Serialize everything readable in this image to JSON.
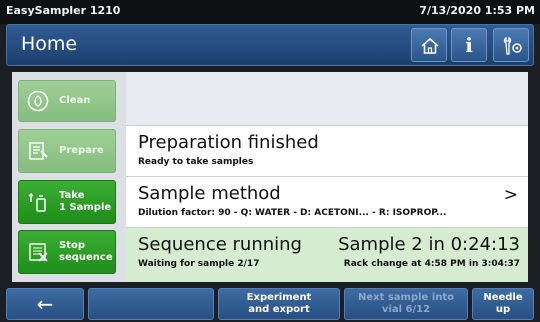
{
  "status_bar": {
    "app_name": "EasySampler 1210",
    "datetime": "7/13/2020 1:53 PM"
  },
  "header": {
    "title": "Home",
    "icons": [
      "home-icon",
      "info-icon",
      "tools-icon"
    ],
    "info_glyph": "i"
  },
  "side_buttons": [
    {
      "label_line1": "Clean",
      "label_line2": "",
      "state": "disabled",
      "icon": "clean-icon"
    },
    {
      "label_line1": "Prepare",
      "label_line2": "",
      "state": "disabled",
      "icon": "prepare-icon"
    },
    {
      "label_line1": "Take",
      "label_line2": "1 Sample",
      "state": "enabled",
      "icon": "take-sample-icon"
    },
    {
      "label_line1": "Stop",
      "label_line2": "sequence",
      "state": "enabled",
      "icon": "stop-sequence-icon"
    }
  ],
  "info_rows": [
    {
      "heading": "",
      "subtext": ""
    },
    {
      "heading": "Preparation finished",
      "subtext": "Ready to take samples"
    },
    {
      "heading": "Sample method",
      "subtext": "Dilution factor: 90 - Q: WATER - D: ACETONI... - R: ISOPROP...",
      "chevron": ">"
    },
    {
      "heading": "Sequence running",
      "subtext": "Waiting for sample 2/17",
      "right_heading": "Sample 2 in 0:24:13",
      "right_subtext": "Rack change at 4:58 PM in 3:04:37"
    }
  ],
  "bottom_bar": {
    "back_icon": "←",
    "experiment_line1": "Experiment",
    "experiment_line2": "and export",
    "next_line1": "Next sample into",
    "next_line2": "vial 6/12",
    "needle_line1": "Needle",
    "needle_line2": "up"
  },
  "colors": {
    "header_blue": "#2f5c93",
    "active_green": "#2a9e24",
    "disabled_green": "#93c78b",
    "panel_gray": "#dcdfe3",
    "highlight_green": "#d6ecd0"
  }
}
